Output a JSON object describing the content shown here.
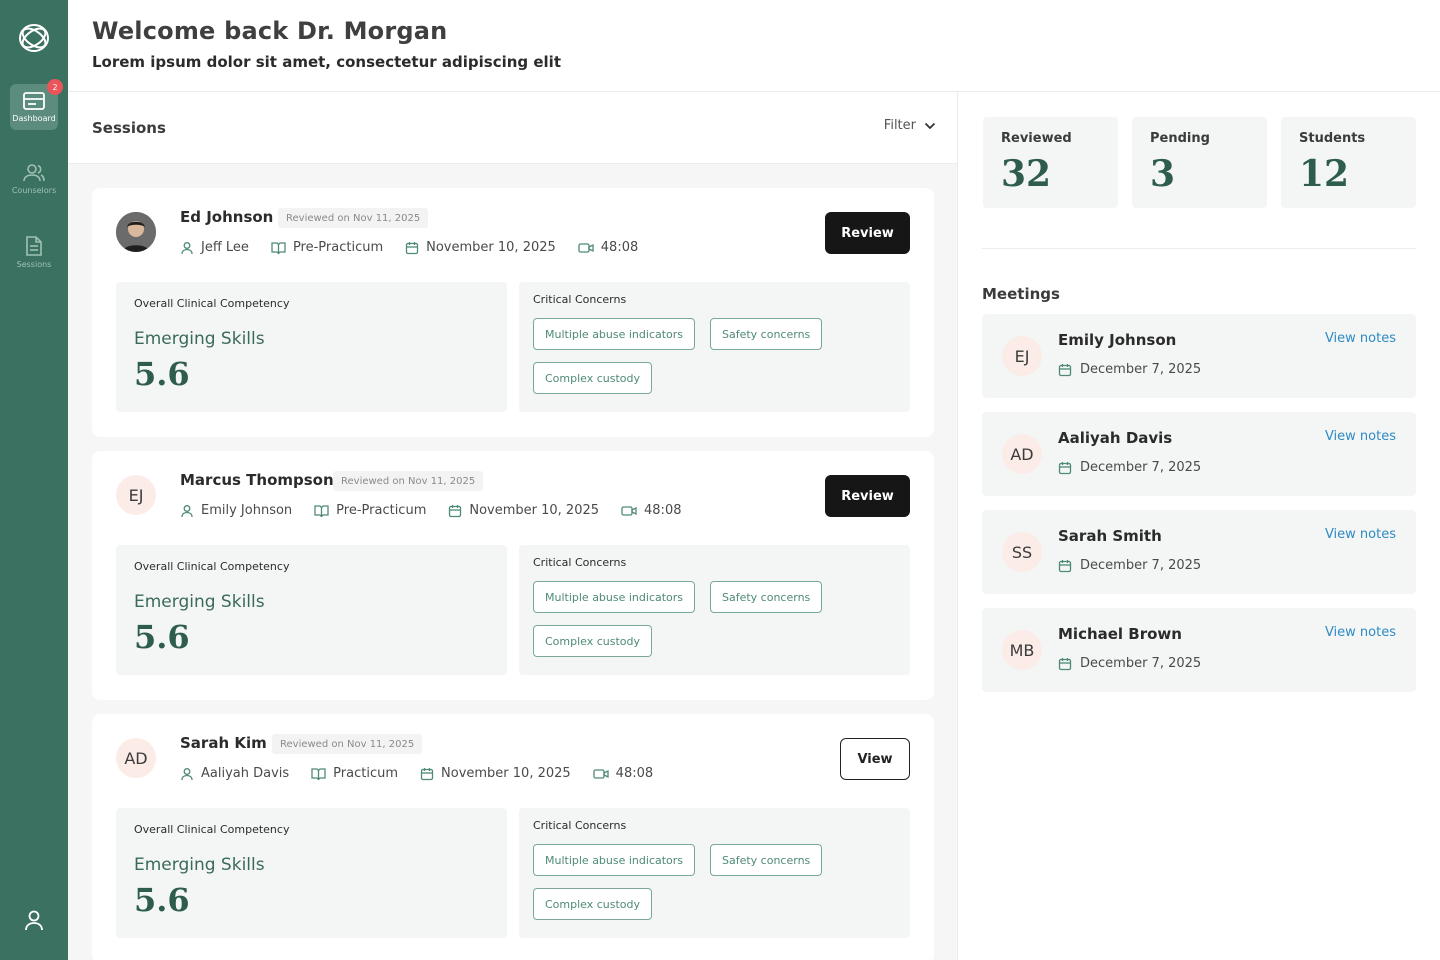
{
  "sidebar": {
    "nav": [
      {
        "label": "Dashboard",
        "icon": "dashboard-icon",
        "active": true,
        "badge": "2"
      },
      {
        "label": "Counselors",
        "icon": "users-icon",
        "active": false
      },
      {
        "label": "Sessions",
        "icon": "document-icon",
        "active": false
      }
    ],
    "profile_icon": "user-icon"
  },
  "header": {
    "title": "Welcome back Dr. Morgan",
    "subtitle": "Lorem ipsum dolor sit amet, consectetur adipiscing elit"
  },
  "sessions": {
    "title": "Sessions",
    "filter_label": "Filter",
    "items": [
      {
        "student": "Ed Johnson",
        "avatar": "photo",
        "reviewed": "Reviewed on Nov 11, 2025",
        "counselor": "Jeff Lee",
        "program": "Pre-Practicum",
        "date": "November 10, 2025",
        "duration": "48:08",
        "action": "Review",
        "competency_label": "Overall Clinical Competency",
        "competency_level": "Emerging Skills",
        "competency_score": "5.6",
        "concerns_label": "Critical Concerns",
        "concerns": [
          "Multiple abuse indicators",
          "Safety concerns",
          "Complex custody"
        ]
      },
      {
        "student": "Marcus Thompson",
        "avatar": "EJ",
        "reviewed": "Reviewed on Nov 11, 2025",
        "counselor": "Emily Johnson",
        "program": "Pre-Practicum",
        "date": "November 10, 2025",
        "duration": "48:08",
        "action": "Review",
        "competency_label": "Overall Clinical Competency",
        "competency_level": "Emerging Skills",
        "competency_score": "5.6",
        "concerns_label": "Critical Concerns",
        "concerns": [
          "Multiple abuse indicators",
          "Safety concerns",
          "Complex custody"
        ]
      },
      {
        "student": "Sarah Kim",
        "avatar": "AD",
        "reviewed": "Reviewed on Nov 11, 2025",
        "counselor": "Aaliyah Davis",
        "program": "Practicum",
        "date": "November 10, 2025",
        "duration": "48:08",
        "action": "View",
        "competency_label": "Overall Clinical Competency",
        "competency_level": "Emerging Skills",
        "competency_score": "5.6",
        "concerns_label": "Critical Concerns",
        "concerns": [
          "Multiple abuse indicators",
          "Safety concerns",
          "Complex custody"
        ]
      }
    ]
  },
  "stats": [
    {
      "label": "Reviewed",
      "value": "32"
    },
    {
      "label": "Pending",
      "value": "3"
    },
    {
      "label": "Students",
      "value": "12"
    }
  ],
  "meetings": {
    "title": "Meetings",
    "link_label": "View notes",
    "items": [
      {
        "initials": "EJ",
        "name": "Emily Johnson",
        "date": "December 7, 2025"
      },
      {
        "initials": "AD",
        "name": "Aaliyah Davis",
        "date": "December 7, 2025"
      },
      {
        "initials": "SS",
        "name": "Sarah Smith",
        "date": "December 7, 2025"
      },
      {
        "initials": "MB",
        "name": "Michael Brown",
        "date": "December 7, 2025"
      }
    ]
  },
  "colors": {
    "sidebar": "#3b7160",
    "accent_green": "#2e5c4e",
    "link_blue": "#2f8ac4",
    "badge_red": "#e9555a"
  }
}
